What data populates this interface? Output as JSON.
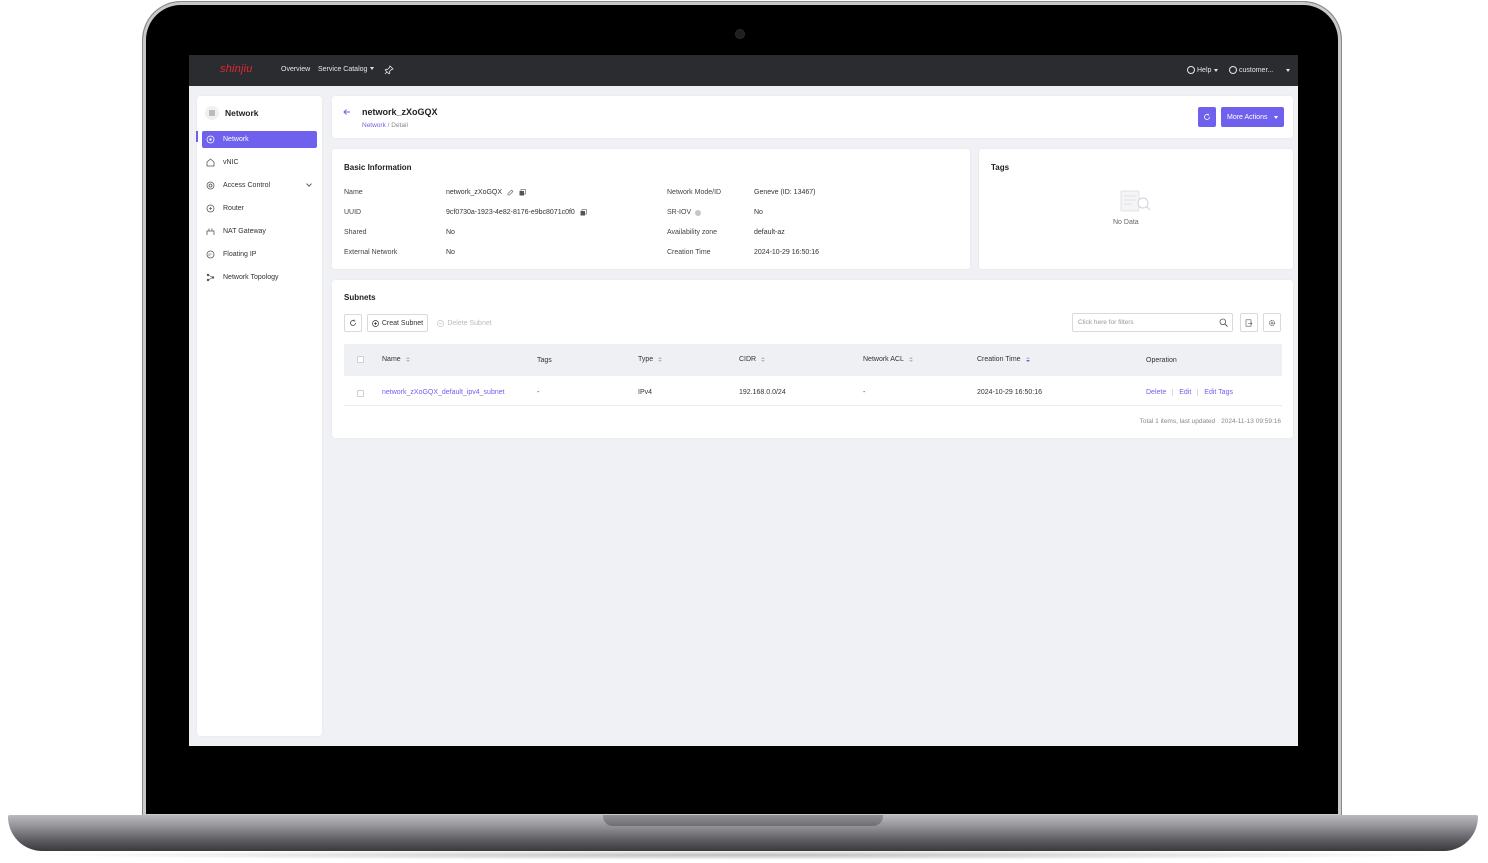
{
  "topbar": {
    "logo": "shinjiu",
    "nav": [
      "Overview",
      "Service Catalog"
    ],
    "help": "Help",
    "user": "customer..."
  },
  "sidebar": {
    "title": "Network",
    "items": [
      {
        "label": "Network",
        "icon": "network-icon",
        "active": true
      },
      {
        "label": "vNIC",
        "icon": "vnic-icon"
      },
      {
        "label": "Access Control",
        "icon": "access-control-icon"
      },
      {
        "label": "Router",
        "icon": "router-icon"
      },
      {
        "label": "NAT Gateway",
        "icon": "nat-gateway-icon"
      },
      {
        "label": "Floating IP",
        "icon": "floating-ip-icon"
      },
      {
        "label": "Network Topology",
        "icon": "topology-icon"
      }
    ]
  },
  "header": {
    "title": "network_zXoGQX",
    "breadcrumb_link": "Network",
    "breadcrumb_sep": " / ",
    "breadcrumb_current": "Detail",
    "more_actions": "More Actions"
  },
  "basic": {
    "title": "Basic Information",
    "left": [
      {
        "label": "Name",
        "value": "network_zXoGQX"
      },
      {
        "label": "UUID",
        "value": "9cf0730a-1923-4e82-8176-e9bc8071c0f0"
      },
      {
        "label": "Shared",
        "value": "No"
      },
      {
        "label": "External Network",
        "value": "No"
      }
    ],
    "right": [
      {
        "label": "Network Mode/ID",
        "value": "Geneve (ID: 13467)"
      },
      {
        "label": "SR-IOV",
        "value": "No"
      },
      {
        "label": "Availability zone",
        "value": "default-az"
      },
      {
        "label": "Creation Time",
        "value": "2024-10-29 16:50:16"
      }
    ]
  },
  "tags": {
    "title": "Tags",
    "empty": "No Data"
  },
  "subnets": {
    "title": "Subnets",
    "create_label": "Creat Subnet",
    "delete_label": "Delete Subnet",
    "search_placeholder": "Click here for filters",
    "columns": [
      "Name",
      "Tags",
      "Type",
      "CIDR",
      "Network ACL",
      "Creation Time",
      "Operation"
    ],
    "rows": [
      {
        "name": "network_zXoGQX_default_ipv4_subnet",
        "tags": "-",
        "type": "IPv4",
        "cidr": "192.168.0.0/24",
        "acl": "-",
        "created": "2024-10-29 16:50:16",
        "ops": [
          "Delete",
          "Edit",
          "Edit Tags"
        ]
      }
    ],
    "footer_total": "Total 1 items, last updated",
    "footer_time": "2024-11-13 09:59:16"
  },
  "colors": {
    "accent": "#6f61ee",
    "logo": "#e3262e",
    "topbar": "#2b2c30"
  }
}
